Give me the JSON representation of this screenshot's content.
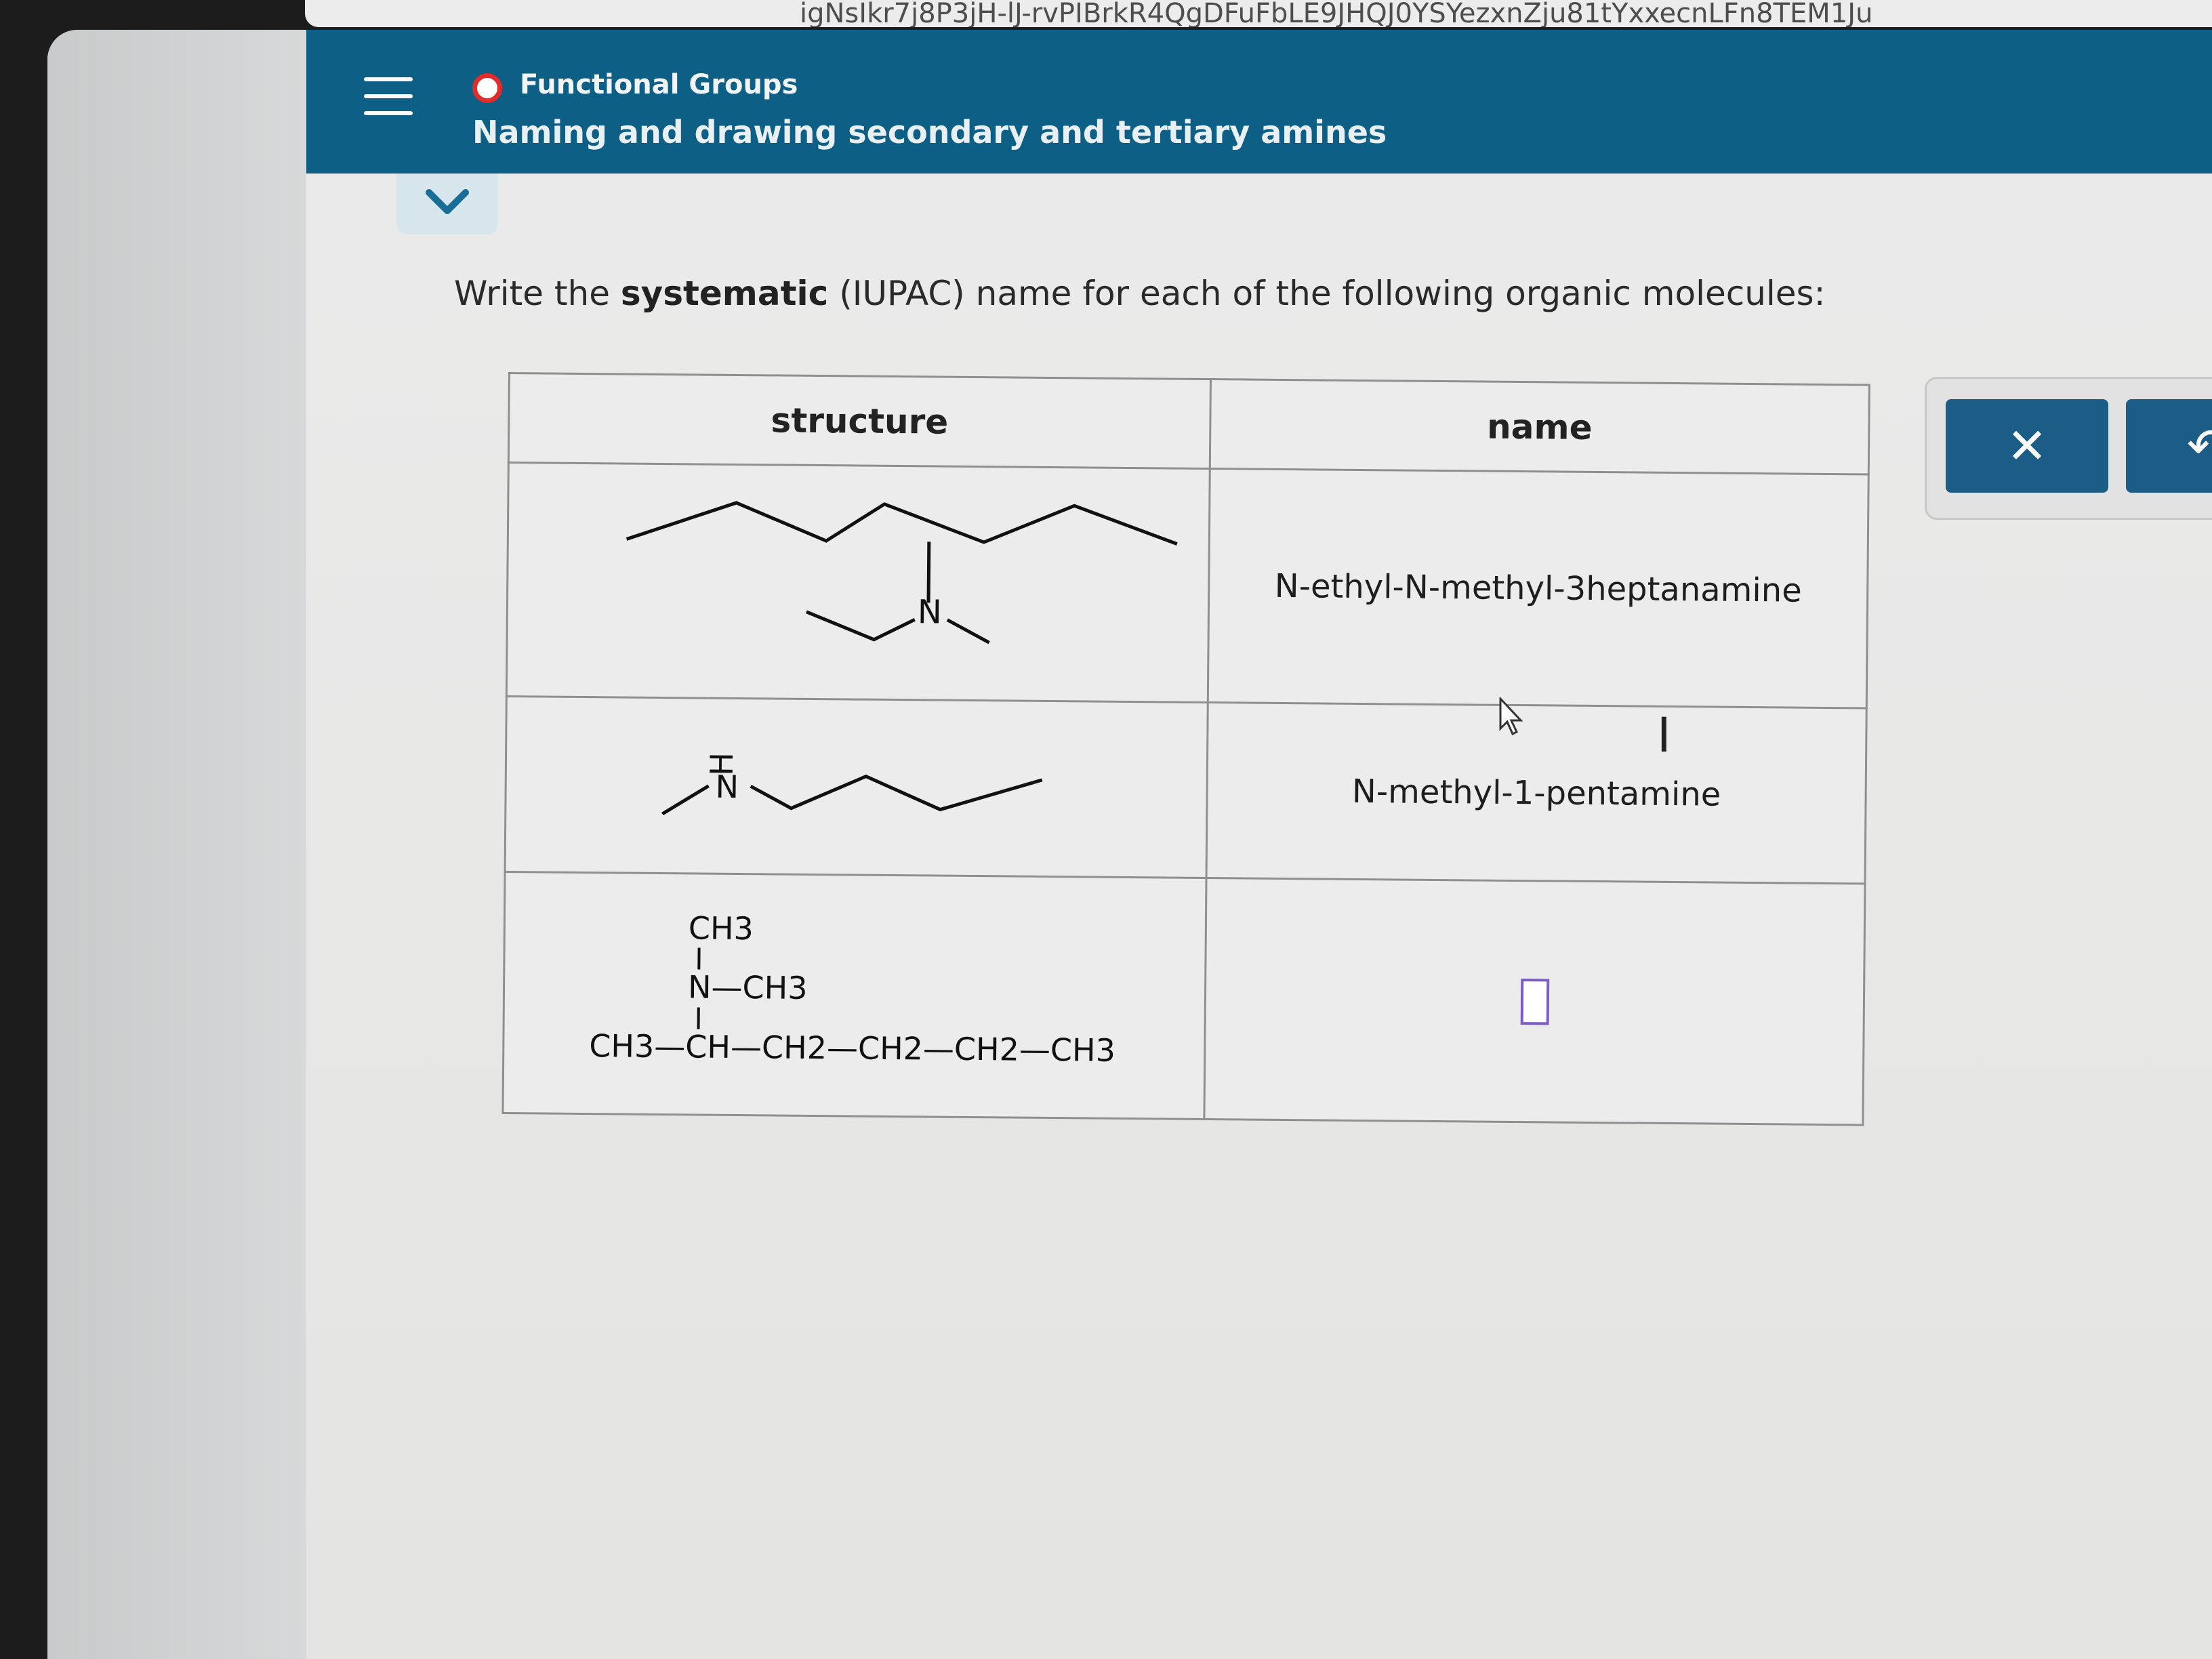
{
  "browser": {
    "url_fragment": "igNsIkr7j8P3jH-lJ-rvPIBrkR4QgDFuFbLE9JHQJ0YSYezxnZju81tYxxecnLFn8TEM1Ju"
  },
  "header": {
    "topic": "Functional Groups",
    "title": "Naming and drawing secondary and tertiary amines"
  },
  "question": {
    "prompt_prefix": "Write the ",
    "prompt_bold": "systematic",
    "prompt_suffix": " (IUPAC) name for each of the following organic molecules:"
  },
  "table": {
    "headers": [
      "structure",
      "name"
    ],
    "rows": [
      {
        "structure_id": "skeletal-heptanamine",
        "name": "N-ethyl-N-methyl-3heptanamine"
      },
      {
        "structure_id": "skeletal-pentanamine",
        "name": "N-methyl-1-pentamine"
      },
      {
        "structure_id": "condensed-hexanamine",
        "name": ""
      }
    ]
  },
  "structures": {
    "row1": {
      "atom_n": "N"
    },
    "row2": {
      "atom_h": "H",
      "atom_n": "N"
    },
    "row3": {
      "top_group": "CH3",
      "middle_group": "N—CH3",
      "chain": "CH3—CH—CH2—CH2—CH2—CH3"
    }
  },
  "tools": {
    "clear_icon": "close-icon",
    "undo_icon": "undo-icon",
    "clear_symbol": "✕",
    "undo_symbol": "↶"
  },
  "colors": {
    "header_bg": "#0e5f85",
    "tool_button": "#1c5d88",
    "record_dot": "#e22b2b",
    "answer_box_border": "#7a5cc4"
  }
}
